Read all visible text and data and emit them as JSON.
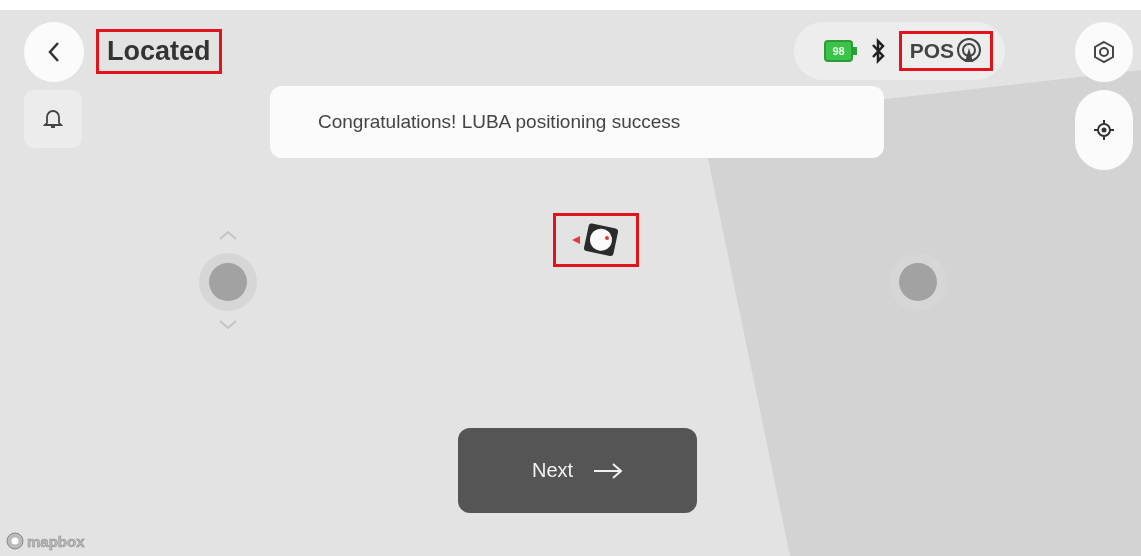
{
  "header": {
    "title": "Located",
    "highlighted": true
  },
  "status": {
    "battery": "98",
    "position_label": "POS",
    "highlighted": true
  },
  "toast": {
    "message": "Congratulations! LUBA positioning success"
  },
  "robot": {
    "highlighted": true
  },
  "next_button": {
    "label": "Next"
  },
  "map": {
    "attribution": "mapbox"
  }
}
